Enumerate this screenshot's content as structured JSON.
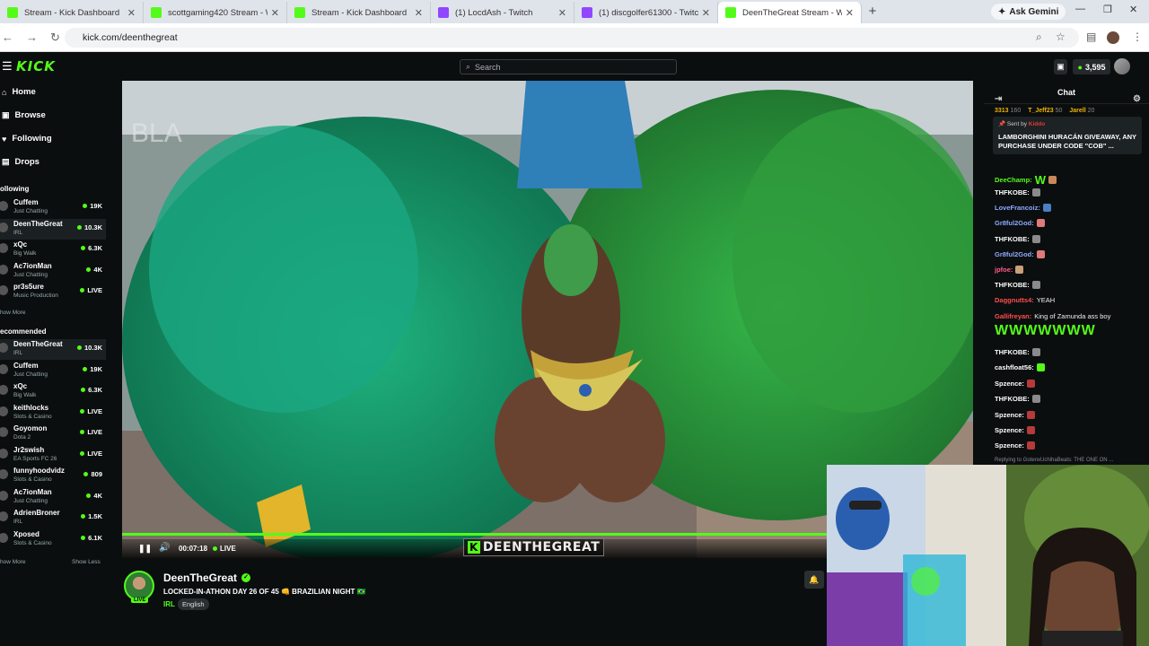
{
  "browser": {
    "tabs": [
      {
        "title": "Stream - Kick Dashboard",
        "icon": "kick",
        "active": false
      },
      {
        "title": "scottgaming420 Stream - Watc",
        "icon": "kick",
        "active": false
      },
      {
        "title": "Stream - Kick Dashboard",
        "icon": "kick",
        "active": false
      },
      {
        "title": "(1) LocdAsh - Twitch",
        "icon": "twitch",
        "active": false
      },
      {
        "title": "(1) discgolfer61300 - Twitch",
        "icon": "twitch",
        "active": false
      },
      {
        "title": "DeenTheGreat Stream - Wa",
        "icon": "kick",
        "active": true
      }
    ],
    "new_tab": "+",
    "gemini_label": "Ask Gemini",
    "url": "kick.com/deenthegreat"
  },
  "header": {
    "logo": "KICK",
    "search_placeholder": "Search",
    "points": "3,595"
  },
  "sidebar": {
    "nav": [
      {
        "label": "Home",
        "icon": "home-icon",
        "glyph": "⌂"
      },
      {
        "label": "Browse",
        "icon": "browse-icon",
        "glyph": "▣"
      },
      {
        "label": "Following",
        "icon": "heart-icon",
        "glyph": "♥"
      },
      {
        "label": "Drops",
        "icon": "drops-icon",
        "glyph": "▤"
      }
    ],
    "following_title": "ollowing",
    "following": [
      {
        "name": "Cuffem",
        "category": "Just Chatting",
        "viewers": "19K"
      },
      {
        "name": "DeenTheGreat",
        "category": "IRL",
        "viewers": "10.3K"
      },
      {
        "name": "xQc",
        "category": "Big Walk",
        "viewers": "6.3K"
      },
      {
        "name": "Ac7ionMan",
        "category": "Just Chatting",
        "viewers": "4K"
      },
      {
        "name": "pr3s5ure",
        "category": "Music Production",
        "viewers": "LIVE"
      }
    ],
    "show_more_1": "how More",
    "recommended_title": "ecommended",
    "recommended": [
      {
        "name": "DeenTheGreat",
        "category": "IRL",
        "viewers": "10.3K"
      },
      {
        "name": "Cuffem",
        "category": "Just Chatting",
        "viewers": "19K"
      },
      {
        "name": "xQc",
        "category": "Big Walk",
        "viewers": "6.3K"
      },
      {
        "name": "keithlocks",
        "category": "Slots & Casino",
        "viewers": "LIVE"
      },
      {
        "name": "Goyomon",
        "category": "Dota 2",
        "viewers": "LIVE"
      },
      {
        "name": "Jr2swish",
        "category": "EA Sports FC 26",
        "viewers": "LIVE"
      },
      {
        "name": "funnyhoodvidz",
        "category": "Slots & Casino",
        "viewers": "809"
      },
      {
        "name": "Ac7ionMan",
        "category": "Just Chatting",
        "viewers": "4K"
      },
      {
        "name": "AdrienBroner",
        "category": "IRL",
        "viewers": "1.5K"
      },
      {
        "name": "Xposed",
        "category": "Slots & Casino",
        "viewers": "6.1K"
      }
    ],
    "show_more_2": "how More",
    "show_less": "Show Less"
  },
  "player": {
    "elapsed": "00:07:18",
    "live_label": "LIVE",
    "progress": 1.0,
    "watermark": "DEENTHEGREAT"
  },
  "stream": {
    "streamer": "DeenTheGreat",
    "title": "LOCKED-IN-ATHON DAY 26 OF 45 👊 BRAZILIAN NIGHT 🇧🇷",
    "category": "IRL",
    "language": "English",
    "live_badge": "LIVE"
  },
  "chat": {
    "title": "Chat",
    "gifters": [
      {
        "name": "3313",
        "count": "160"
      },
      {
        "name": "T_Jeff23",
        "count": "50"
      },
      {
        "name": "Jarell",
        "count": "20"
      }
    ],
    "pinned": {
      "sent_by_label": "Sent by",
      "sender": "Kiddo",
      "message": "LAMBORGHINI HURACÁN GIVEAWAY, ANY PURCHASE UNDER CODE \"COB\" ..."
    },
    "messages": [
      {
        "user": "DeeChamp:",
        "color": "#53fc18",
        "text": "W"
      },
      {
        "user": "THFKOBE:",
        "color": "#ffffff",
        "text": ""
      },
      {
        "user": "LoveFrancoiz:",
        "color": "#8fa9ff",
        "text": ""
      },
      {
        "user": "Gr8ful2God:",
        "color": "#8fa9ff",
        "text": ""
      },
      {
        "user": "THFKOBE:",
        "color": "#ffffff",
        "text": ""
      },
      {
        "user": "Gr8ful2God:",
        "color": "#8fa9ff",
        "text": ""
      },
      {
        "user": "jpfoe:",
        "color": "#ff5c8a",
        "text": ""
      },
      {
        "user": "THFKOBE:",
        "color": "#ffffff",
        "text": ""
      },
      {
        "user": "Daggnutts4:",
        "color": "#ff4d4d",
        "text": "YEAH"
      },
      {
        "user": "Gallifreyan:",
        "color": "#ff4d4d",
        "text": "King of Zamunda ass boy"
      },
      {
        "user": "",
        "color": "#53fc18",
        "text": "WWWWWWW"
      },
      {
        "user": "THFKOBE:",
        "color": "#ffffff",
        "text": ""
      },
      {
        "user": "cashfloat56:",
        "color": "#ffffff",
        "text": ""
      },
      {
        "user": "Spzence:",
        "color": "#ffffff",
        "text": ""
      },
      {
        "user": "THFKOBE:",
        "color": "#ffffff",
        "text": ""
      },
      {
        "user": "Spzence:",
        "color": "#ffffff",
        "text": ""
      },
      {
        "user": "Spzence:",
        "color": "#ffffff",
        "text": ""
      },
      {
        "user": "Spzence:",
        "color": "#ffffff",
        "text": ""
      }
    ],
    "replying": "Replying to GotenxUchihaBeats: THE ONE ON ..."
  },
  "colors": {
    "accent": "#53fc18",
    "background": "#0b0e0f"
  }
}
